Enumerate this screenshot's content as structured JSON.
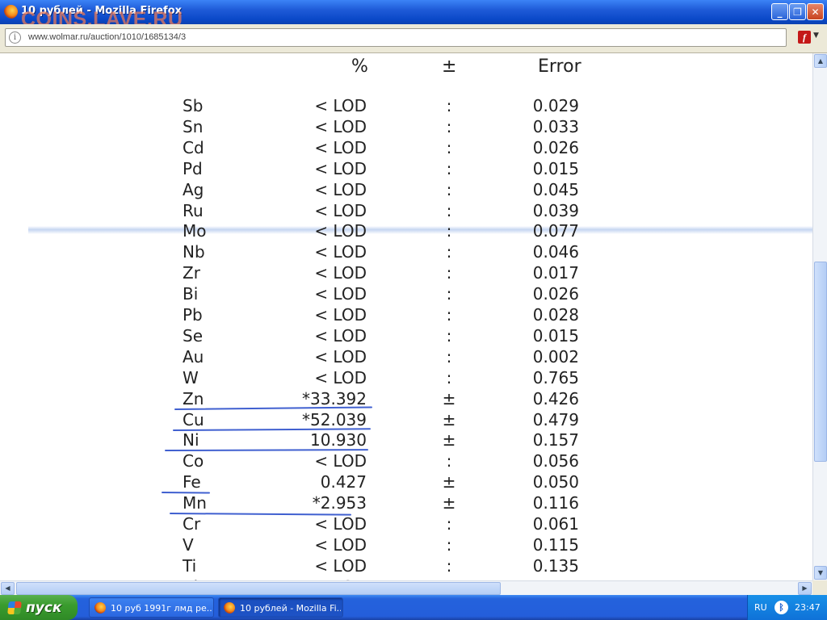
{
  "window": {
    "title": "10 рублей - Mozilla Firefox",
    "watermark": "COINS.LAVE.RU",
    "minimize_label": "_",
    "maximize_label": "❐",
    "close_label": "✕"
  },
  "address_bar": {
    "url": "www.wolmar.ru/auction/1010/1685134/3"
  },
  "table": {
    "headers": {
      "percent": "%",
      "plusminus": "±",
      "error": "Error"
    },
    "rows": [
      {
        "element": "Sb",
        "value": "< LOD",
        "sep": ":",
        "error": "0.029"
      },
      {
        "element": "Sn",
        "value": "< LOD",
        "sep": ":",
        "error": "0.033"
      },
      {
        "element": "Cd",
        "value": "< LOD",
        "sep": ":",
        "error": "0.026"
      },
      {
        "element": "Pd",
        "value": "< LOD",
        "sep": ":",
        "error": "0.015"
      },
      {
        "element": "Ag",
        "value": "< LOD",
        "sep": ":",
        "error": "0.045"
      },
      {
        "element": "Ru",
        "value": "< LOD",
        "sep": ":",
        "error": "0.039"
      },
      {
        "element": "Mo",
        "value": "< LOD",
        "sep": ":",
        "error": "0.077"
      },
      {
        "element": "Nb",
        "value": "< LOD",
        "sep": ":",
        "error": "0.046"
      },
      {
        "element": "Zr",
        "value": "< LOD",
        "sep": ":",
        "error": "0.017"
      },
      {
        "element": "Bi",
        "value": "< LOD",
        "sep": ":",
        "error": "0.026"
      },
      {
        "element": "Pb",
        "value": "< LOD",
        "sep": ":",
        "error": "0.028"
      },
      {
        "element": "Se",
        "value": "< LOD",
        "sep": ":",
        "error": "0.015"
      },
      {
        "element": "Au",
        "value": "< LOD",
        "sep": ":",
        "error": "0.002"
      },
      {
        "element": "W",
        "value": "< LOD",
        "sep": ":",
        "error": "0.765"
      },
      {
        "element": "Zn",
        "value": "*33.392",
        "sep": "±",
        "error": "0.426"
      },
      {
        "element": "Cu",
        "value": "*52.039",
        "sep": "±",
        "error": "0.479"
      },
      {
        "element": "Ni",
        "value": "10.930",
        "sep": "±",
        "error": "0.157"
      },
      {
        "element": "Co",
        "value": "< LOD",
        "sep": ":",
        "error": "0.056"
      },
      {
        "element": "Fe",
        "value": "0.427",
        "sep": "±",
        "error": "0.050"
      },
      {
        "element": "Mn",
        "value": "*2.953",
        "sep": "±",
        "error": "0.116"
      },
      {
        "element": "Cr",
        "value": "< LOD",
        "sep": ":",
        "error": "0.061"
      },
      {
        "element": "V",
        "value": "< LOD",
        "sep": ":",
        "error": "0.115"
      },
      {
        "element": "Ti",
        "value": "< LOD",
        "sep": ":",
        "error": "0.135"
      },
      {
        "element": "Al",
        "value": "< LOD",
        "sep": ":",
        "error": ""
      }
    ]
  },
  "taskbar": {
    "start_label": "пуск",
    "tasks": [
      {
        "label": "10 руб 1991г лмд ре..."
      },
      {
        "label": "10 рублей - Mozilla Fi..."
      }
    ],
    "language": "RU",
    "clock": "23:47"
  }
}
